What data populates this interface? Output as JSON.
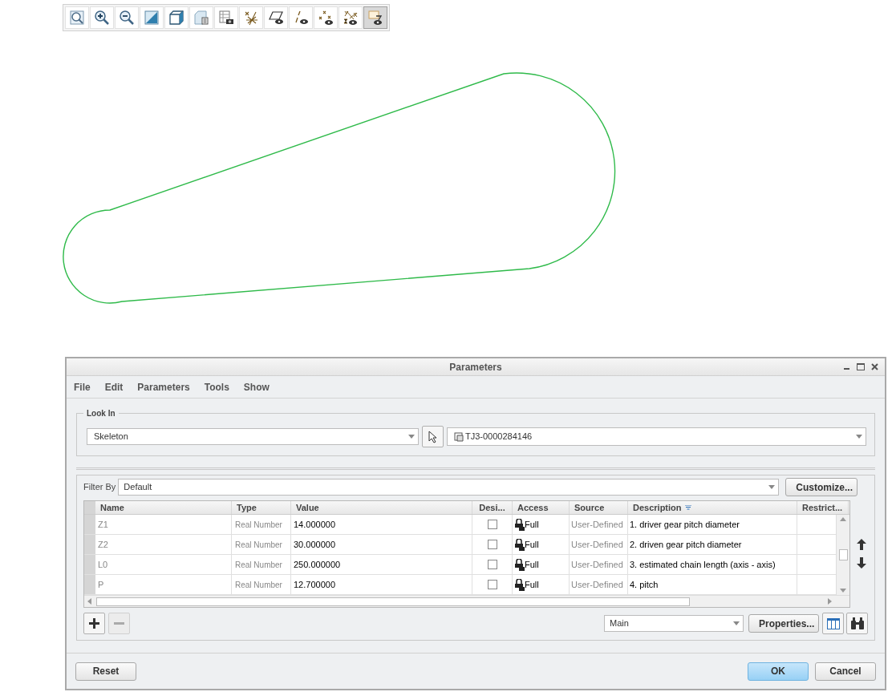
{
  "toolbar": [
    {
      "kind": "zoom",
      "selected": false
    },
    {
      "kind": "zoom-in",
      "selected": false
    },
    {
      "kind": "zoom-out",
      "selected": false
    },
    {
      "kind": "plane",
      "selected": false
    },
    {
      "kind": "cube",
      "selected": false
    },
    {
      "kind": "sheet",
      "selected": false
    },
    {
      "kind": "table",
      "selected": false
    },
    {
      "kind": "datums",
      "selected": false
    },
    {
      "kind": "plane-eye",
      "selected": false
    },
    {
      "kind": "axis-eye",
      "selected": false
    },
    {
      "kind": "point-eye",
      "selected": false
    },
    {
      "kind": "csys-eye",
      "selected": false
    },
    {
      "kind": "annot-eye",
      "selected": true
    }
  ],
  "dialog": {
    "title": "Parameters",
    "menu": [
      "File",
      "Edit",
      "Parameters",
      "Tools",
      "Show"
    ],
    "look_in": {
      "label": "Look In",
      "context": "Skeleton",
      "model": "TJ3-0000284146"
    },
    "filter": {
      "label": "Filter By",
      "value": "Default",
      "button": "Customize..."
    },
    "table": {
      "columns": [
        "Name",
        "Type",
        "Value",
        "Desi...",
        "Access",
        "Source",
        "Description",
        "Restrict..."
      ],
      "rows": [
        {
          "name": "Z1",
          "type": "Real Number",
          "value": "14.000000",
          "designate": false,
          "access": "Full",
          "source": "User-Defined",
          "description": "1. driver gear pitch diameter"
        },
        {
          "name": "Z2",
          "type": "Real Number",
          "value": "30.000000",
          "designate": false,
          "access": "Full",
          "source": "User-Defined",
          "description": "2. driven gear pitch diameter"
        },
        {
          "name": "L0",
          "type": "Real Number",
          "value": "250.000000",
          "designate": false,
          "access": "Full",
          "source": "User-Defined",
          "description": "3. estimated chain length (axis - axis)"
        },
        {
          "name": "P",
          "type": "Real Number",
          "value": "12.700000",
          "designate": false,
          "access": "Full",
          "source": "User-Defined",
          "description": "4. pitch"
        }
      ]
    },
    "scope": "Main",
    "properties_button": "Properties...",
    "buttons": {
      "reset": "Reset",
      "ok": "OK",
      "cancel": "Cancel"
    }
  }
}
